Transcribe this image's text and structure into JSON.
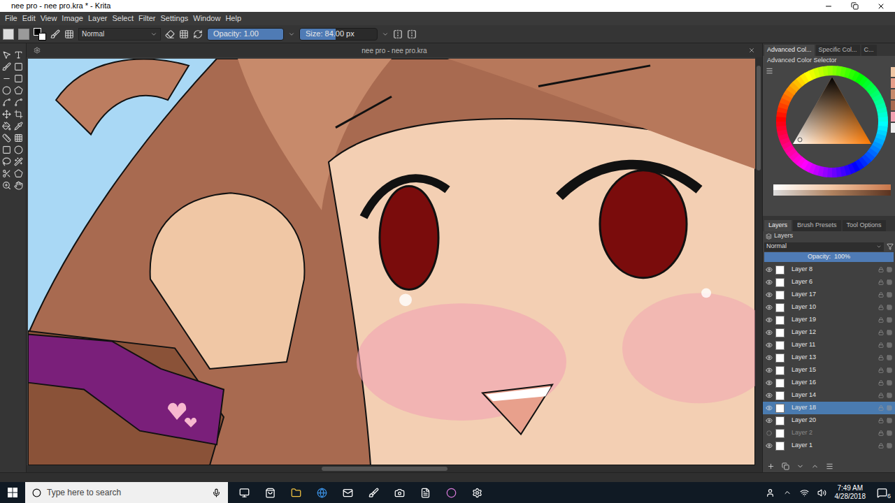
{
  "window": {
    "title": "nee pro - nee pro.kra * - Krita"
  },
  "menu": [
    "File",
    "Edit",
    "View",
    "Image",
    "Layer",
    "Select",
    "Filter",
    "Settings",
    "Window",
    "Help"
  ],
  "toolbar": {
    "blend_mode": "Normal",
    "opacity": {
      "label": "Opacity: 1.00",
      "level": 1
    },
    "size": {
      "label": "Size: 84.00 px",
      "level": 0.46
    }
  },
  "document": {
    "title": "nee pro - nee pro.kra"
  },
  "docker_tabs": [
    {
      "label": "Advanced Col...",
      "selected": true
    },
    {
      "label": "Specific Col...",
      "selected": false
    },
    {
      "label": "C...",
      "selected": false
    }
  ],
  "color_selector": {
    "title": "Advanced Color Selector"
  },
  "panel_tabs": [
    {
      "label": "Layers",
      "selected": true
    },
    {
      "label": "Brush Presets",
      "selected": false
    },
    {
      "label": "Tool Options",
      "selected": false
    }
  ],
  "layers": {
    "title": "Layers",
    "blend_mode": "Normal",
    "opacity": {
      "label": "Opacity:  100%",
      "level": 1
    },
    "items": [
      {
        "name": "Layer 8",
        "visible": true,
        "selected": false
      },
      {
        "name": "Layer 6",
        "visible": true,
        "selected": false
      },
      {
        "name": "Layer 17",
        "visible": true,
        "selected": false
      },
      {
        "name": "Layer 10",
        "visible": true,
        "selected": false
      },
      {
        "name": "Layer 19",
        "visible": true,
        "selected": false
      },
      {
        "name": "Layer 12",
        "visible": true,
        "selected": false
      },
      {
        "name": "Layer 11",
        "visible": true,
        "selected": false
      },
      {
        "name": "Layer 13",
        "visible": true,
        "selected": false
      },
      {
        "name": "Layer 15",
        "visible": true,
        "selected": false
      },
      {
        "name": "Layer 16",
        "visible": true,
        "selected": false
      },
      {
        "name": "Layer 14",
        "visible": true,
        "selected": false
      },
      {
        "name": "Layer 18",
        "visible": true,
        "selected": true
      },
      {
        "name": "Layer 20",
        "visible": true,
        "selected": false
      },
      {
        "name": "Layer 2",
        "visible": false,
        "selected": false
      },
      {
        "name": "Layer 1",
        "visible": true,
        "selected": false
      }
    ]
  },
  "taskbar": {
    "search_placeholder": "Type here to search",
    "time": "7:49 AM",
    "date": "4/28/2018",
    "notifications": "6"
  }
}
